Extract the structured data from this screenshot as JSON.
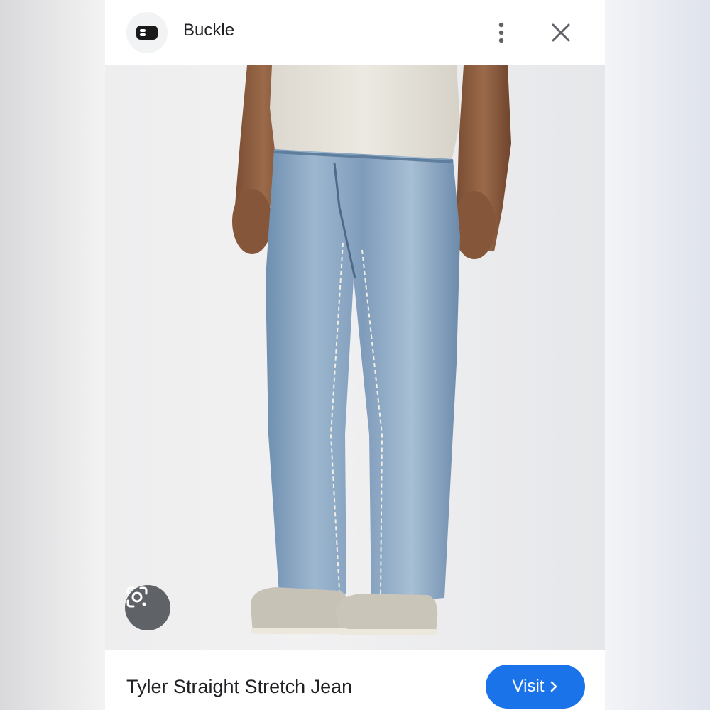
{
  "header": {
    "site_name": "Buckle",
    "site_icon": "buckle-logo-icon",
    "more_icon": "more-vert-icon",
    "close_icon": "close-icon"
  },
  "image": {
    "lens_icon": "google-lens-icon"
  },
  "footer": {
    "product_title": "Tyler Straight Stretch Jean",
    "visit_label": "Visit",
    "visit_icon": "chevron-right-icon"
  },
  "colors": {
    "accent": "#1a73e8",
    "text": "#202124",
    "icon": "#5f6368",
    "denim": "#7fa0c1"
  }
}
